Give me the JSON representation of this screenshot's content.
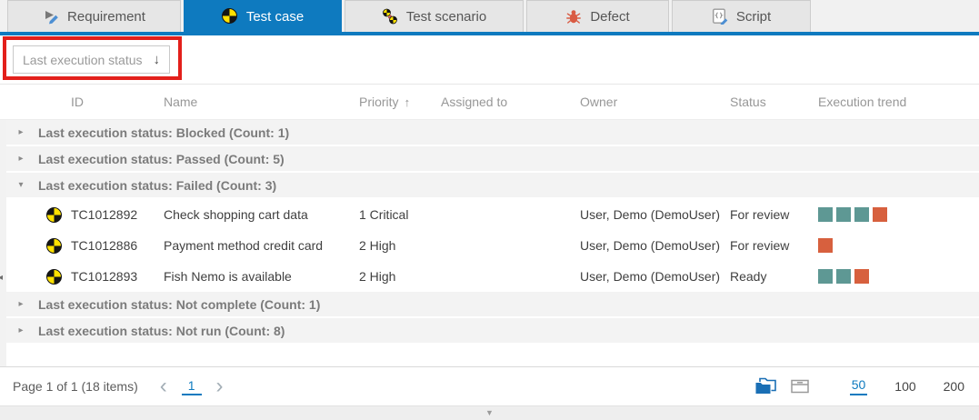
{
  "tabs": {
    "items": [
      {
        "label": "Requirement",
        "icon": "requirement-icon",
        "active": false
      },
      {
        "label": "Test case",
        "icon": "test-case-icon",
        "active": true
      },
      {
        "label": "Test scenario",
        "icon": "test-scenario-icon",
        "active": false
      },
      {
        "label": "Defect",
        "icon": "defect-icon",
        "active": false
      },
      {
        "label": "Script",
        "icon": "script-icon",
        "active": false
      }
    ]
  },
  "group_panel": {
    "field_label": "Last execution status",
    "sort_icon": "↓"
  },
  "icons": {
    "collapsed": "▸",
    "expanded": "▾",
    "sort_asc": "↑",
    "prev": "‹",
    "next": "›",
    "left_splitter": "◂",
    "bottom_splitter": "▼"
  },
  "table": {
    "columns": {
      "id": "ID",
      "name": "Name",
      "priority": "Priority",
      "assigned_to": "Assigned to",
      "owner": "Owner",
      "status": "Status",
      "execution_trend": "Execution trend"
    },
    "sort": {
      "column": "Priority",
      "direction": "ascending"
    },
    "grouped_by": "Last execution status",
    "groups": [
      {
        "label": "Last execution status: Blocked (Count: 1)",
        "expanded": false,
        "rows": []
      },
      {
        "label": "Last execution status: Passed (Count: 5)",
        "expanded": false,
        "rows": []
      },
      {
        "label": "Last execution status: Failed (Count: 3)",
        "expanded": true,
        "rows": [
          {
            "id": "TC1012892",
            "name": "Check shopping cart data",
            "priority": "1 Critical",
            "assigned_to": "",
            "owner": "User, Demo (DemoUser)",
            "status": "For review",
            "trend": [
              "pass",
              "pass",
              "pass",
              "fail"
            ]
          },
          {
            "id": "TC1012886",
            "name": "Payment method credit card",
            "priority": "2 High",
            "assigned_to": "",
            "owner": "User, Demo (DemoUser)",
            "status": "For review",
            "trend": [
              "fail"
            ]
          },
          {
            "id": "TC1012893",
            "name": "Fish Nemo is available",
            "priority": "2 High",
            "assigned_to": "",
            "owner": "User, Demo (DemoUser)",
            "status": "Ready",
            "trend": [
              "pass",
              "pass",
              "fail"
            ]
          }
        ]
      },
      {
        "label": "Last execution status: Not complete (Count: 1)",
        "expanded": false,
        "rows": []
      },
      {
        "label": "Last execution status: Not run (Count: 8)",
        "expanded": false,
        "rows": []
      }
    ]
  },
  "footer": {
    "page_info": "Page 1 of 1 (18 items)",
    "current_page": "1",
    "page_sizes": [
      "50",
      "100",
      "200"
    ],
    "selected_page_size": "50"
  },
  "colors": {
    "accent_blue": "#0e7abf",
    "trend_pass": "#5e9894",
    "trend_fail": "#d7603e",
    "annotation_red": "#e3201b"
  }
}
